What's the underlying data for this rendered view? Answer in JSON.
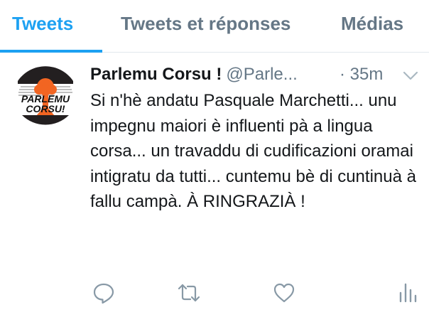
{
  "tabs": [
    {
      "label": "Tweets",
      "active": true
    },
    {
      "label": "Tweets et réponses",
      "active": false
    },
    {
      "label": "Médias",
      "active": false
    }
  ],
  "tweet": {
    "author_name": "Parlemu Corsu !",
    "handle": "@Parle...",
    "time": "· 35m",
    "text": "Si n'hè andatu Pasquale Marchetti... unu impegnu maiori è influenti pà a lingua corsa... un travaddu di cudificazioni oramai intigratu da tutti... cuntemu bè di cuntinuà à fallu campà. À RINGRAZIÀ !",
    "avatar_text_line1": "PARLEMU",
    "avatar_text_line2": "CORSU!"
  },
  "actions": {
    "reply_icon": "reply-icon",
    "retweet_icon": "retweet-icon",
    "like_icon": "heart-icon",
    "analytics_icon": "analytics-icon"
  },
  "colors": {
    "accent": "#1da1f2",
    "secondary_text": "#657786",
    "primary_text": "#14171a",
    "avatar_orange": "#f26522"
  }
}
